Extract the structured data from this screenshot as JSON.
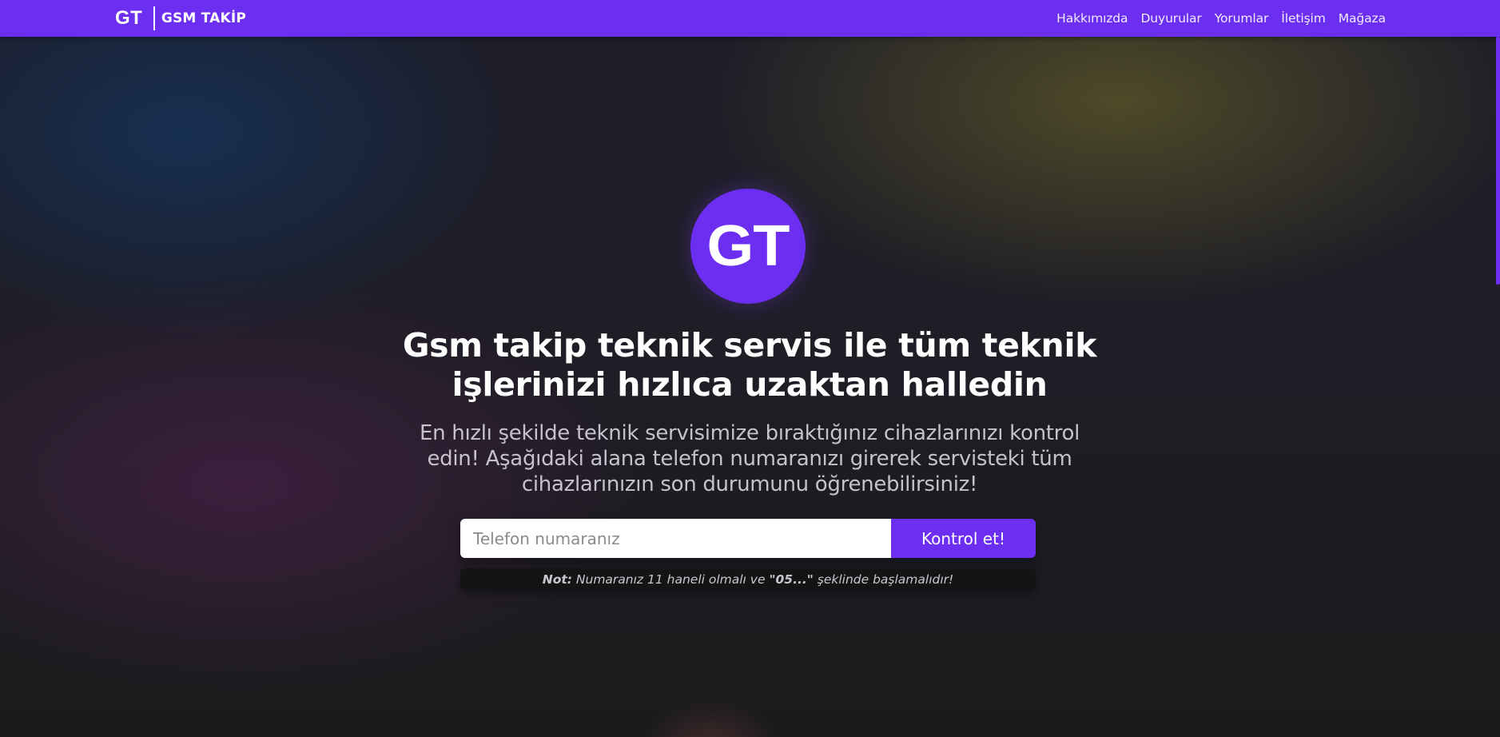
{
  "header": {
    "brand_mark": "GT",
    "brand_name": "GSM TAKİP",
    "nav": [
      "Hakkımızda",
      "Duyurular",
      "Yorumlar",
      "İletişim",
      "Mağaza"
    ]
  },
  "hero": {
    "logo_text": "GT",
    "title": "Gsm takip teknik servis ile tüm teknik işlerinizi hızlıca uzaktan halledin",
    "subtitle": "En hızlı şekilde teknik servisimize bıraktığınız cihazlarınızı kontrol edin! Aşağıdaki alana telefon numaranızı girerek servisteki tüm cihazlarınızın son durumunu öğrenebilirsiniz!",
    "search": {
      "placeholder": "Telefon numaranız",
      "value": "",
      "button_label": "Kontrol et!"
    },
    "note": {
      "label": "Not:",
      "text_before": " Numaranız 11 haneli olmalı ve ",
      "highlight": "\"05...\"",
      "text_after": " şeklinde başlamalıdır!"
    }
  },
  "colors": {
    "accent": "#6c2ff2",
    "background": "#1d1c20",
    "note_background": "#141416"
  }
}
